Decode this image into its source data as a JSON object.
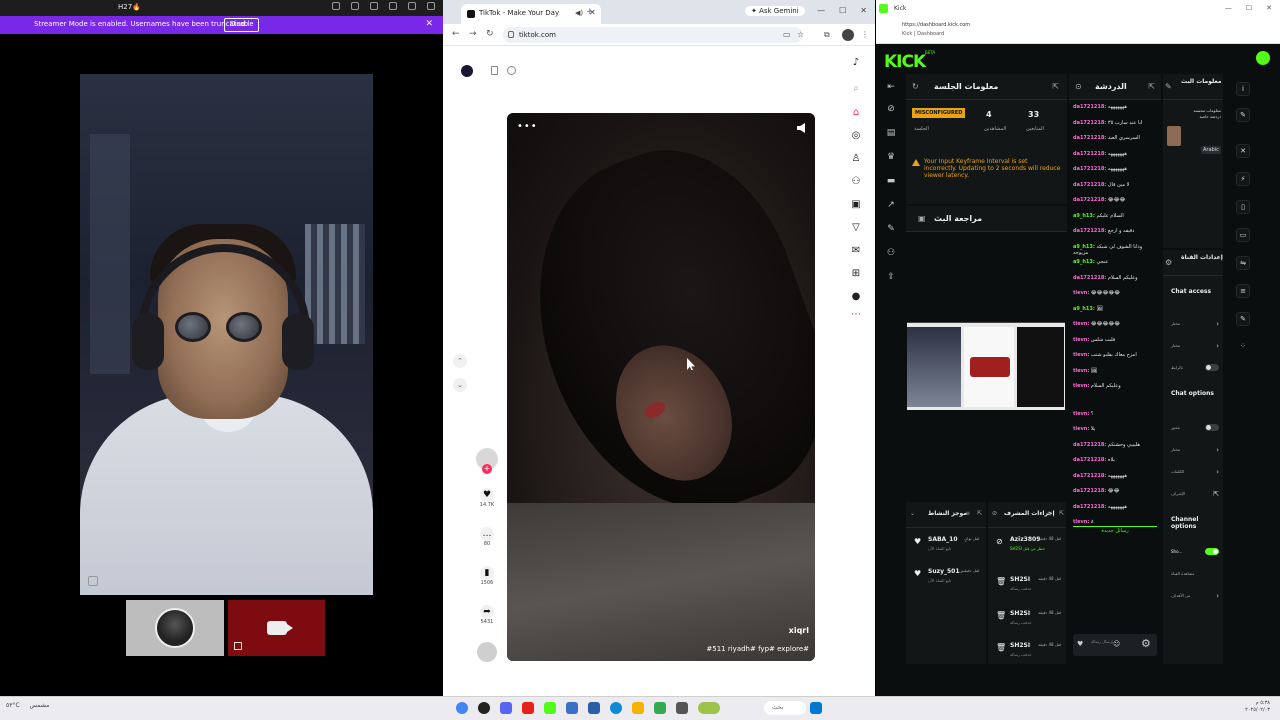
{
  "call_window": {
    "title": "H27🔥",
    "banner_text": "Streamer Mode is enabled. Usernames have been truncated.",
    "disable_label": "Disable",
    "close_glyph": "✕"
  },
  "browser": {
    "tab_title": "TikTok - Make Your Day",
    "tab_close": "✕",
    "new_tab": "+",
    "ask_gemini": "✦ Ask Gemini",
    "url": "tiktok.com",
    "win_controls": [
      "—",
      "☐",
      "✕"
    ]
  },
  "tiktok": {
    "video": {
      "author": "xiqrl",
      "caption": "#511 riyadh# fyp# explore#",
      "menu_glyph": "•••"
    },
    "actions": {
      "likes": "14.7K",
      "comments": "80",
      "saves": "1506",
      "shares": "5431"
    },
    "icons": [
      "tiktok-logo-icon",
      "search-icon",
      "home-icon",
      "explore-icon",
      "following-icon",
      "friends-icon",
      "live-icon",
      "activity-icon",
      "messages-icon",
      "upload-icon",
      "profile-icon",
      "more-icon"
    ]
  },
  "kick": {
    "tab_title": "Kick",
    "url": "https://dashboard.kick.com",
    "addr_sub": "Kick | Dashboard",
    "logo": "KICK",
    "logo_sup": "BETA",
    "session": {
      "title": "معلومات الجلسة",
      "status_badge": "MISCONFIGURED",
      "status_label": "الجلسة",
      "viewers": "4",
      "viewers_label": "المشاهدين",
      "followers": "33",
      "followers_label": "المتابعين",
      "warning": "Your Input Keyframe Interval is set incorrectly. Updating to 2 seconds will reduce viewer latency."
    },
    "review_title": "مراجعة البث",
    "chat": {
      "title": "الدردشة",
      "messages": [
        {
          "user": "da1721218:",
          "text": "هههههههه",
          "color": "#ff6ad5"
        },
        {
          "user": "da1721218:",
          "text": "انا عند سارب ٣٥",
          "color": "#ff6ad5"
        },
        {
          "user": "da1721218:",
          "text": "السرسري العبد",
          "color": "#ff6ad5"
        },
        {
          "user": "da1721218:",
          "text": "هههههههه",
          "color": "#ff6ad5"
        },
        {
          "user": "da1721218:",
          "text": "هههههههه",
          "color": "#ff6ad5"
        },
        {
          "user": "da1721218:",
          "text": "لا مين قال",
          "color": "#ff6ad5"
        },
        {
          "user": "da1721218:",
          "text": "😂😂😂",
          "color": "#ff6ad5"
        },
        {
          "user": "a9_h13:",
          "text": "السلام عليكم",
          "color": "#53fc18"
        },
        {
          "user": "da1721218:",
          "text": "دقيقه و ارجع",
          "color": "#ff6ad5"
        },
        {
          "user": "a9_h13:",
          "text": "ودانا الشوف لي شبكه مزيوجه",
          "color": "#53fc18"
        },
        {
          "user": "a9_h13:",
          "text": "عنجي",
          "color": "#53fc18"
        },
        {
          "user": "da1721218:",
          "text": "وعليكم السلام",
          "color": "#ff6ad5"
        },
        {
          "user": "tlevn:",
          "text": "😂😂😂😂😂",
          "color": "#ff6ad5"
        },
        {
          "user": "a9_h13:",
          "text": "🖼",
          "color": "#53fc18"
        },
        {
          "user": "tlevn:",
          "text": "😂😂😂😂😂",
          "color": "#ff6ad5"
        },
        {
          "user": "tlevn:",
          "text": "قلبت شلس",
          "color": "#ff6ad5"
        },
        {
          "user": "tlevn:",
          "text": "امزح معاك يقلبو شتب",
          "color": "#ff6ad5"
        },
        {
          "user": "tlevn:",
          "text": "🖼",
          "color": "#ff6ad5"
        },
        {
          "user": "tlevn:",
          "text": "وعليكم السلام",
          "color": "#ff6ad5"
        },
        {
          "user": "tlevn:",
          "text": "؟",
          "color": "#ff6ad5"
        },
        {
          "user": "tlevn:",
          "text": "يلا",
          "color": "#ff6ad5"
        },
        {
          "user": "da1721218:",
          "text": "هليييي وحشتكم",
          "color": "#ff6ad5"
        },
        {
          "user": "da1721218:",
          "text": "يلاه",
          "color": "#ff6ad5"
        },
        {
          "user": "da1721218:",
          "text": "هههههههه",
          "color": "#ff6ad5"
        },
        {
          "user": "da1721218:",
          "text": "😂😂",
          "color": "#ff6ad5"
        },
        {
          "user": "da1721218:",
          "text": "هههههههه",
          "color": "#ff6ad5"
        },
        {
          "user": "tlevn:",
          "text": "٨",
          "color": "#ff6ad5"
        }
      ],
      "new_messages": "رسائل جديدة",
      "input_placeholder": "إرسال رسالة"
    },
    "stream_info": {
      "title": "معلومات البث",
      "text": "معلومات محسنة دردشة خاصة",
      "tag": "Arabic"
    },
    "chat_cfg": {
      "title": "إعدادات القناة",
      "access_h": "Chat access",
      "access_rows": [
        "مختار",
        "مختار",
        "بالرابط"
      ],
      "options_h": "Chat options",
      "options_rows": [
        "محور",
        "مختار",
        "الكلمات",
        "الإشراف"
      ],
      "channel_h": "Channel options",
      "channel_rows": [
        "Sho...",
        "مشاهدة القناة",
        "من الأهداف"
      ]
    },
    "mods": {
      "title": "موجز النشاط",
      "rows": [
        {
          "name": "SABA_10",
          "sub": "تابع القناة الآن",
          "time": "قبل ثوانٍ"
        },
        {
          "name": "Suzy_501",
          "sub": "تابع القناة الآن",
          "time": "قبل دقيقتين"
        }
      ]
    },
    "mod_actions": {
      "title": "إجراءات المشرف",
      "rows": [
        {
          "name": "Aziz3809",
          "sub": "SH2SI حظر من قبل",
          "time": "قبل 48 دقيقة"
        },
        {
          "name": "SH2SI",
          "sub": "حذفت رسالة",
          "time": "قبل 48 دقيقة"
        },
        {
          "name": "SH2SI",
          "sub": "حذفت رسالة",
          "time": "قبل 48 دقيقة"
        },
        {
          "name": "SH2SI",
          "sub": "حذفت رسالة",
          "time": "قبل 48 دقيقة"
        }
      ]
    }
  },
  "taskbar": {
    "left_items": [
      "٥٣°C",
      "مشمس"
    ],
    "search": "بحث",
    "time": "٥:٣٨ م",
    "date": "٢٠٢٥/٠٢/٠٣"
  }
}
